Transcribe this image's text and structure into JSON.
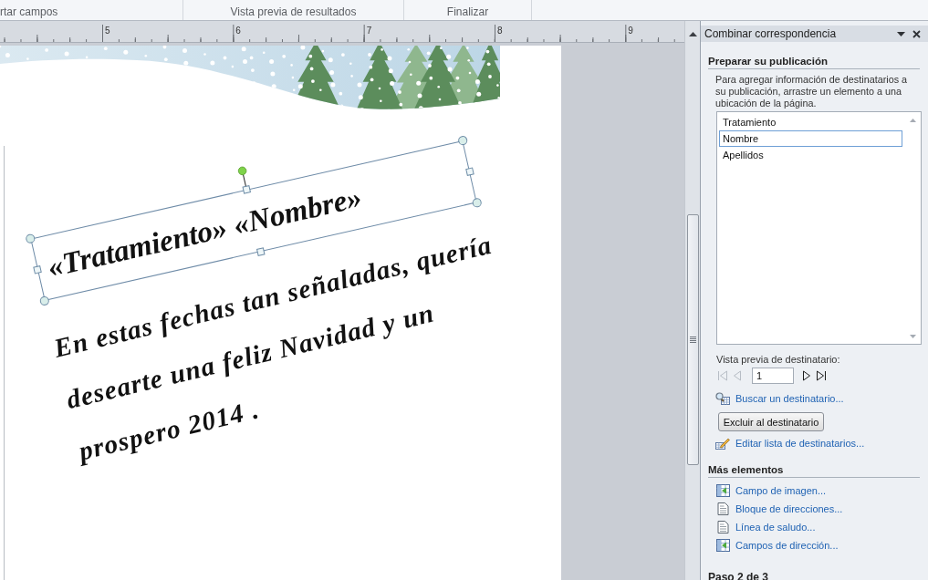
{
  "ribbon": {
    "groups": [
      {
        "label": "rtar campos"
      },
      {
        "label": "Vista previa de resultados"
      },
      {
        "label": "Finalizar"
      }
    ]
  },
  "ruler": {
    "labels": [
      "5",
      "6",
      "7",
      "8",
      "9"
    ]
  },
  "document": {
    "greeting_box": {
      "text": "«Tratamiento» «Nombre»",
      "selected": true
    },
    "body_lines": [
      "En estas fechas tan señaladas, quería",
      "desearte una feliz Navidad y un",
      "prospero 2014 ."
    ]
  },
  "task_pane": {
    "title": "Combinar correspondencia",
    "prepare": {
      "heading": "Preparar su publicación",
      "description": "Para agregar información de destinatarios a su publicación, arrastre un elemento a una ubicación de la página.",
      "fields": [
        {
          "label": "Tratamiento",
          "selected": false
        },
        {
          "label": "Nombre",
          "selected": true
        },
        {
          "label": "Apellidos",
          "selected": false
        }
      ]
    },
    "preview": {
      "label": "Vista previa de destinatario:",
      "record": "1",
      "nav": [
        {
          "kind": "first",
          "disabled": true
        },
        {
          "kind": "previous",
          "disabled": true
        },
        {
          "kind": "next",
          "disabled": false
        },
        {
          "kind": "last",
          "disabled": false
        }
      ],
      "find_link": "Buscar un destinatario...",
      "exclude_button": "Excluir al destinatario",
      "edit_link": "Editar lista de destinatarios..."
    },
    "more": {
      "heading": "Más elementos",
      "items": [
        {
          "kind": "field",
          "label": "Campo de imagen..."
        },
        {
          "kind": "document",
          "label": "Bloque de direcciones..."
        },
        {
          "kind": "document",
          "label": "Línea de saludo..."
        },
        {
          "kind": "field",
          "label": "Campos de dirección..."
        }
      ]
    },
    "step": "Paso 2 de 3"
  }
}
